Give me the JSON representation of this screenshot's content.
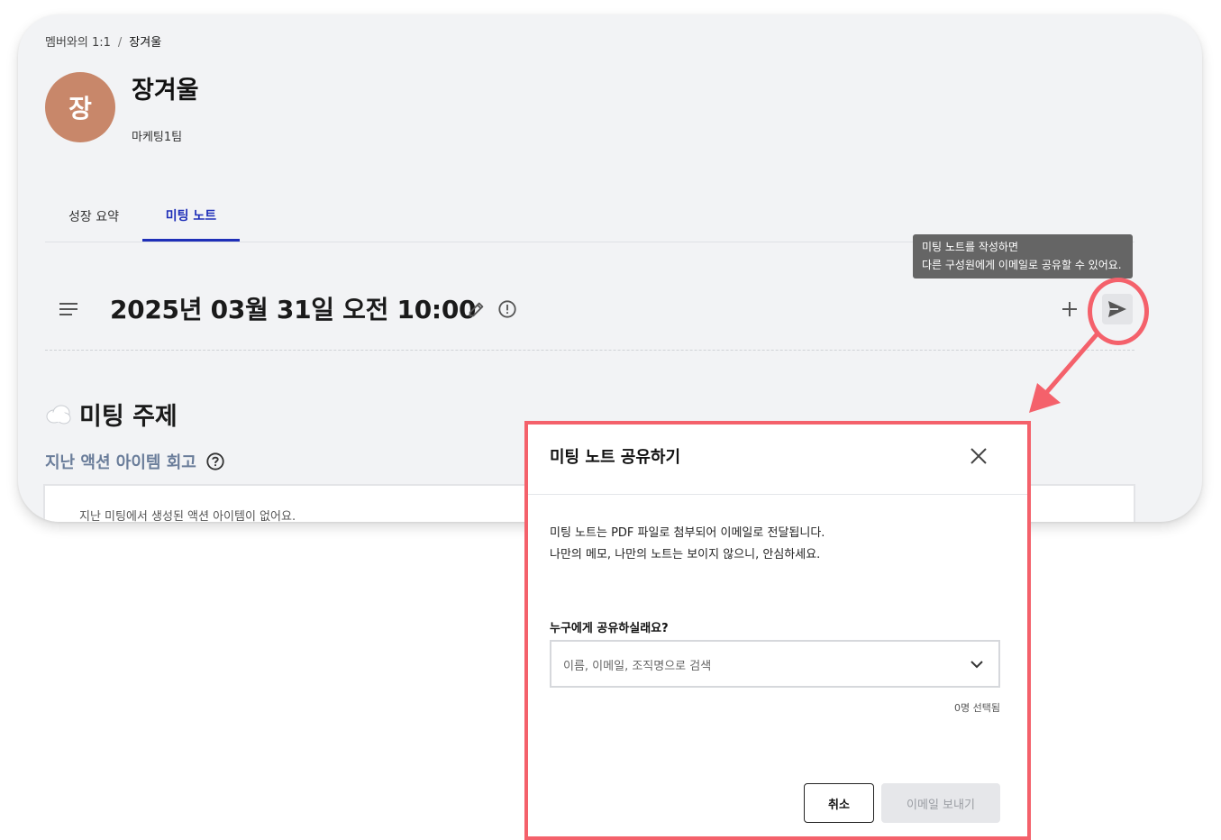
{
  "breadcrumb": {
    "parent": "멤버와의 1:1",
    "separator": "/",
    "current": "장겨울"
  },
  "profile": {
    "avatar_char": "장",
    "avatar_color": "#c8876a",
    "name": "장겨울",
    "team": "마케팅1팀"
  },
  "tabs": [
    {
      "label": "성장 요약",
      "active": false
    },
    {
      "label": "미팅 노트",
      "active": true
    }
  ],
  "accent_color": "#1f2fb8",
  "tooltip": {
    "line1": "미팅 노트를 작성하면",
    "line2": "다른 구성원에게 이메일로 공유할 수 있어요."
  },
  "meeting": {
    "title": "2025년 03월 31일 오전 10:00"
  },
  "topic": {
    "title": "미팅 주제"
  },
  "review": {
    "label": "지난 액션 아이템 회고",
    "empty": "지난 미팅에서 생성된 액션 아이템이 없어요."
  },
  "highlight_color": "#f4616b",
  "modal": {
    "title": "미팅 노트 공유하기",
    "desc_line1": "미팅 노트는 PDF 파일로 첨부되어 이메일로 전달됩니다.",
    "desc_line2": "나만의 메모, 나만의 노트는 보이지 않으니, 안심하세요.",
    "question": "누구에게 공유하실래요?",
    "select_placeholder": "이름, 이메일, 조직명으로 검색",
    "selected_count": "0명 선택됨",
    "cancel_label": "취소",
    "send_label": "이메일 보내기"
  },
  "icons": [
    "menu-icon",
    "edit-icon",
    "info-icon",
    "plus-icon",
    "send-icon",
    "cloud-icon",
    "help-icon",
    "close-icon",
    "chevron-down-icon"
  ]
}
